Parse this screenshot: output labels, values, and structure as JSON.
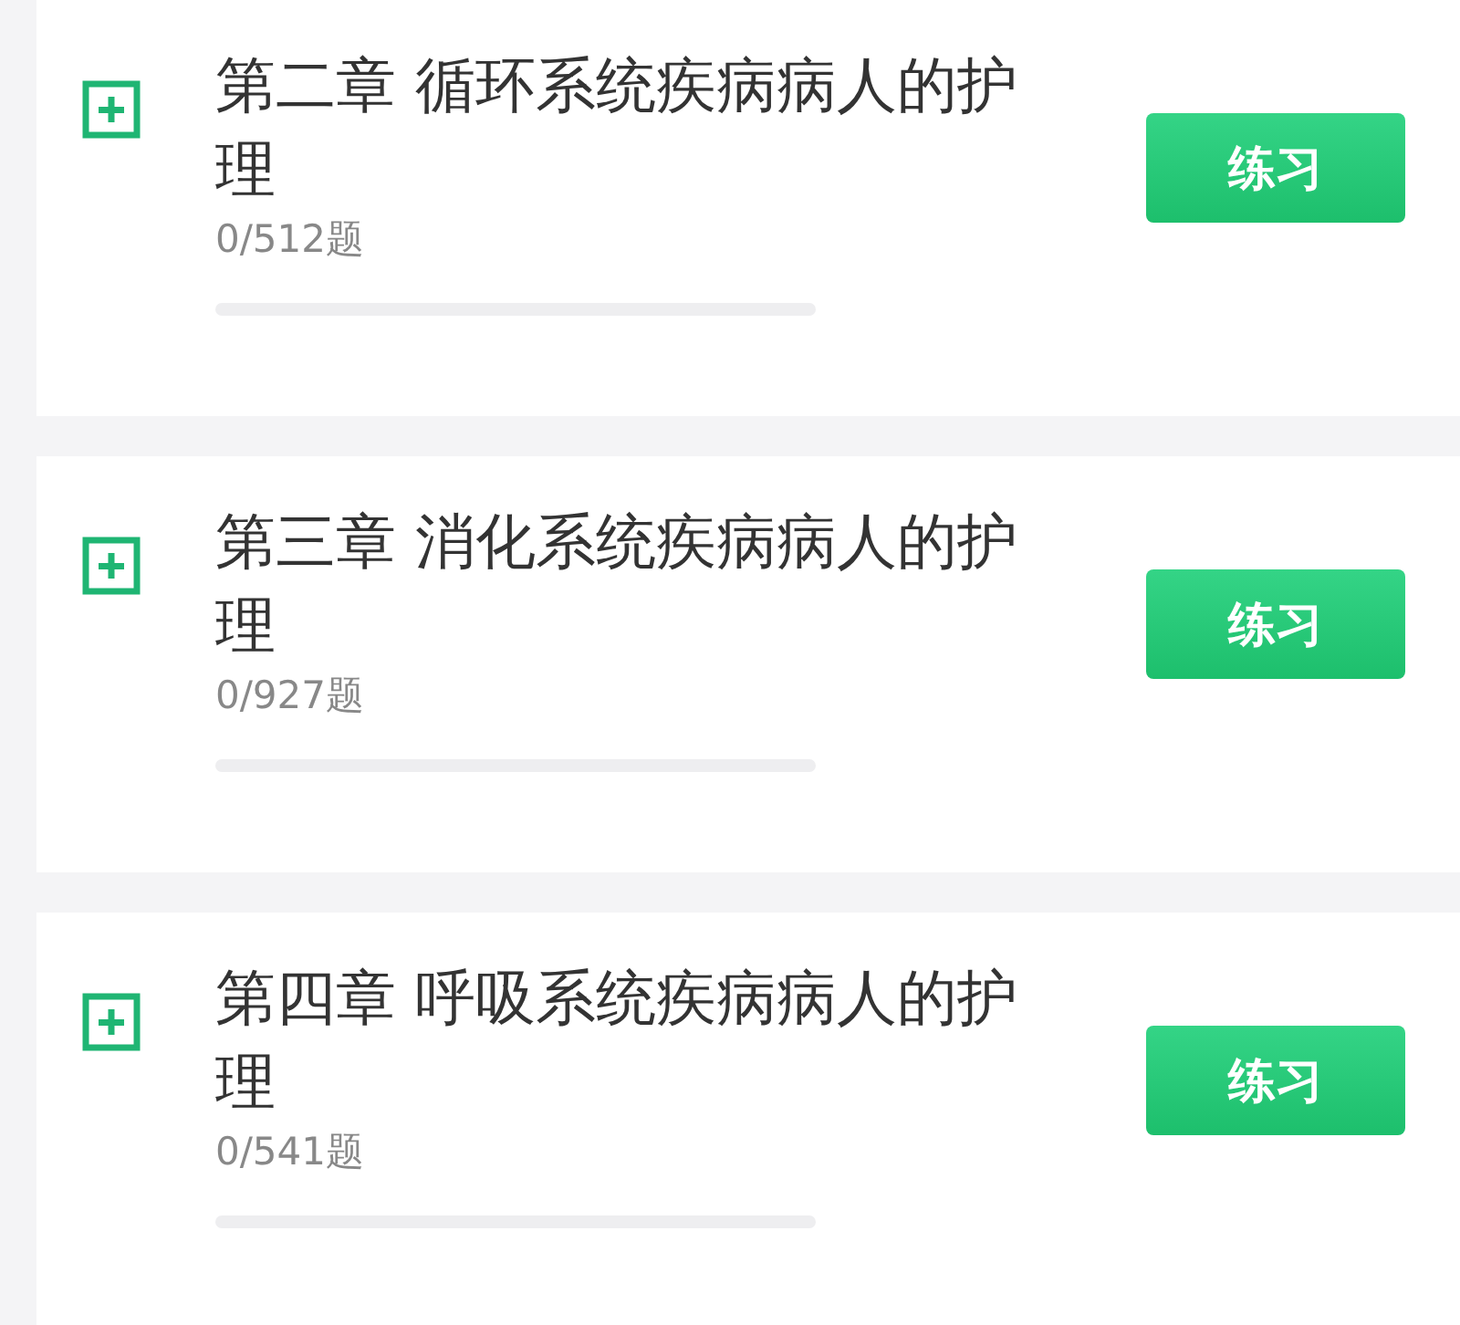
{
  "chapters": [
    {
      "title": "第二章 循环系统疾病病人的护理",
      "count": "0/512题",
      "level": 0,
      "button": "练习"
    },
    {
      "title": "第三章 消化系统疾病病人的护理",
      "count": "0/927题",
      "level": 0,
      "button": "练习"
    },
    {
      "title": "第四章 呼吸系统疾病病人的护理",
      "count": "0/541题",
      "level": 0,
      "button": "练习"
    }
  ]
}
